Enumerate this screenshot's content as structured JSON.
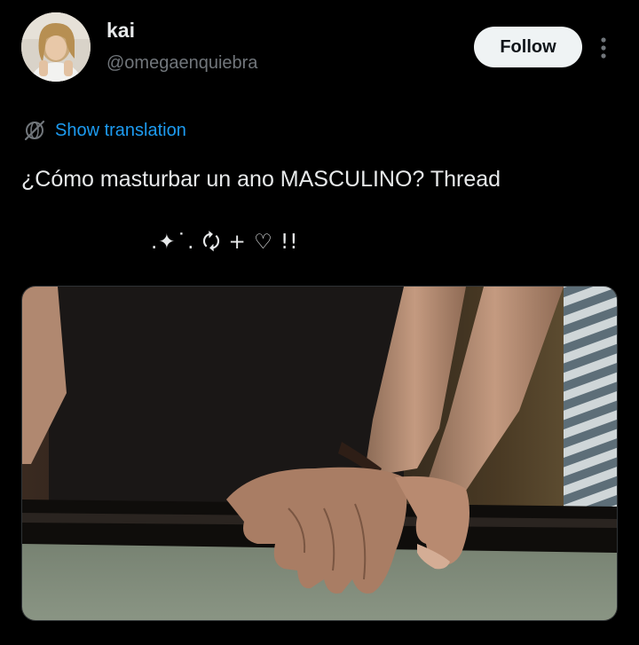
{
  "user": {
    "display_name": "kai",
    "handle": "@omegaenquiebra",
    "avatar_alt": "avatar"
  },
  "actions": {
    "follow_label": "Follow",
    "more_icon": "more-vertical-icon"
  },
  "translation": {
    "icon": "globe-slash-icon",
    "label": "Show translation"
  },
  "tweet": {
    "text": "¿Cómo masturbar un ano MASCULINO? Thread",
    "decoration": ".✦˙. 🗘 + ♡ !!"
  },
  "media": {
    "description": "photo"
  },
  "colors": {
    "background": "#000000",
    "text_primary": "#e7e9ea",
    "text_secondary": "#71767b",
    "link": "#1d9bf0",
    "follow_bg": "#eff3f4",
    "follow_text": "#0f1419"
  }
}
